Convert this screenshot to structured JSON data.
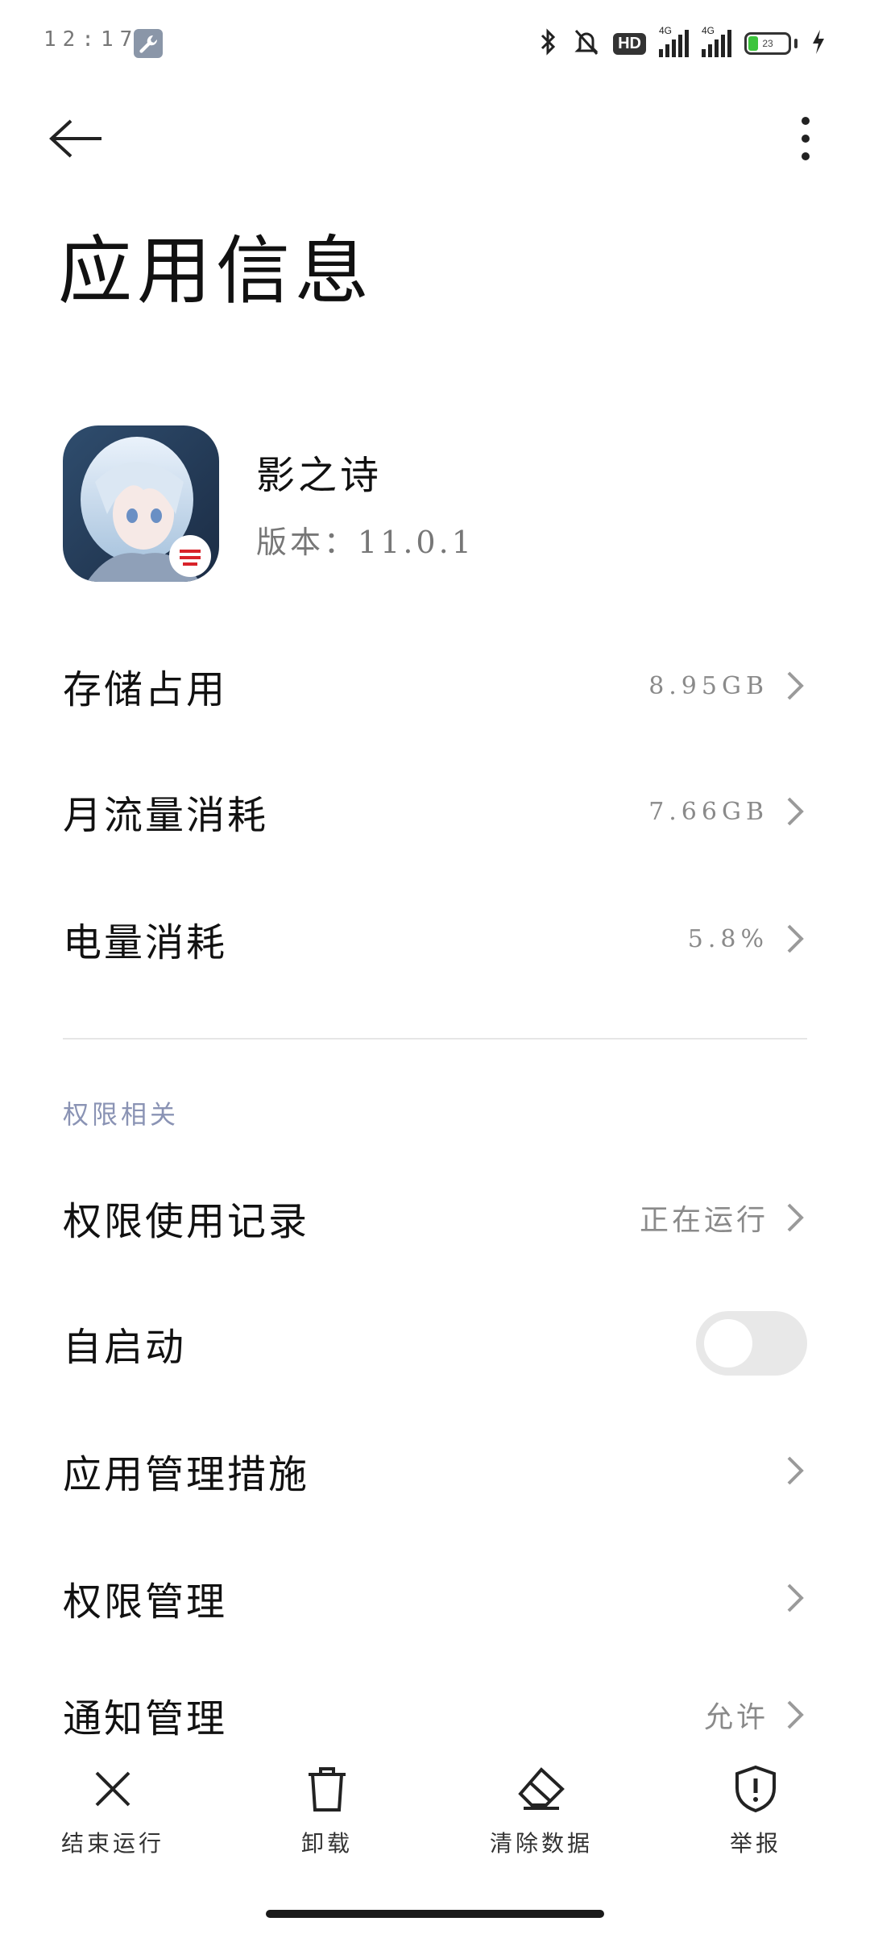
{
  "status_bar": {
    "time": "12:17",
    "hd_label": "HD",
    "network_tag_1": "4G",
    "network_tag_2": "4G",
    "battery_level": "23"
  },
  "header": {
    "title": "应用信息"
  },
  "app": {
    "name": "影之诗",
    "version": "版本：11.0.1",
    "icon": "app-icon-anime-character"
  },
  "usage": {
    "storage_label": "存储占用",
    "storage_value": "8.95GB",
    "data_label": "月流量消耗",
    "data_value": "7.66GB",
    "battery_label": "电量消耗",
    "battery_value": "5.8%"
  },
  "permissions": {
    "section_title": "权限相关",
    "record_label": "权限使用记录",
    "record_value": "正在运行",
    "autostart_label": "自启动",
    "autostart_enabled": false,
    "management_measures_label": "应用管理措施",
    "permission_management_label": "权限管理",
    "notification_label": "通知管理",
    "notification_value": "允许"
  },
  "bottom_actions": {
    "force_stop": "结束运行",
    "uninstall": "卸载",
    "clear_data": "清除数据",
    "report": "举报"
  },
  "colors": {
    "toggle_off": "#e8e8e8",
    "section_header": "#8a93b4",
    "battery_fill": "#3cc43c"
  }
}
